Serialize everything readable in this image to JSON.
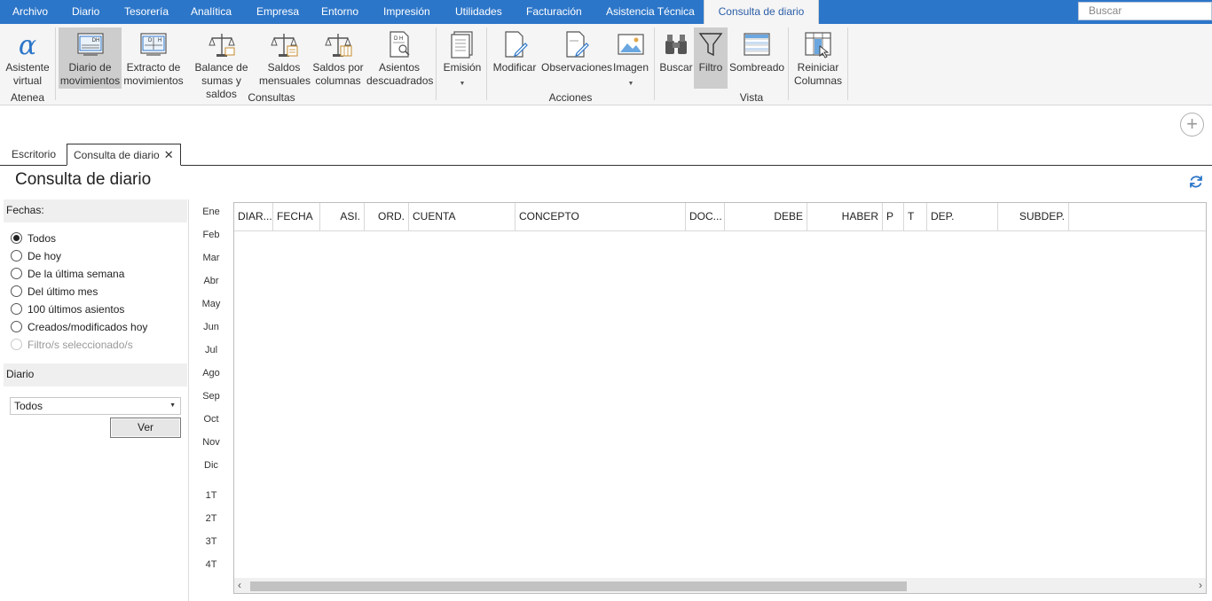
{
  "menu": {
    "items": [
      "Archivo",
      "Diario",
      "Tesorería",
      "Analítica",
      "Empresa",
      "Entorno",
      "Impresión",
      "Utilidades",
      "Facturación",
      "Asistencia Técnica"
    ],
    "active_item": "Consulta de diario",
    "search_placeholder": "Buscar"
  },
  "ribbon": {
    "atenea": {
      "group": "Atenea",
      "asistente": [
        "Asistente",
        "virtual"
      ]
    },
    "consultas": {
      "group": "Consultas",
      "diario_movimientos": [
        "Diario de",
        "movimientos"
      ],
      "extracto": [
        "Extracto de",
        "movimientos"
      ],
      "balance": [
        "Balance de",
        "sumas y saldos"
      ],
      "saldos_mensuales": [
        "Saldos",
        "mensuales"
      ],
      "saldos_columnas": [
        "Saldos por",
        "columnas"
      ],
      "asientos_descuadrados": [
        "Asientos",
        "descuadrados"
      ]
    },
    "emision": {
      "label": "Emisión"
    },
    "acciones": {
      "group": "Acciones",
      "modificar": "Modificar",
      "observaciones": "Observaciones",
      "imagen": "Imagen"
    },
    "vista": {
      "group": "Vista",
      "buscar": "Buscar",
      "filtro": "Filtro",
      "sombreado": "Sombreado",
      "reiniciar": [
        "Reiniciar",
        "Columnas"
      ]
    }
  },
  "tabs": {
    "escritorio": "Escritorio",
    "consulta": "Consulta de diario"
  },
  "page": {
    "title": "Consulta de diario"
  },
  "filters": {
    "fechas_label": "Fechas:",
    "options": [
      "Todos",
      "De hoy",
      "De la última semana",
      "Del último mes",
      "100 últimos asientos",
      "Creados/modificados hoy",
      "Filtro/s seleccionado/s"
    ],
    "selected": "Todos",
    "diario_label": "Diario",
    "diario_value": "Todos",
    "ver_button": "Ver"
  },
  "months": [
    "Ene",
    "Feb",
    "Mar",
    "Abr",
    "May",
    "Jun",
    "Jul",
    "Ago",
    "Sep",
    "Oct",
    "Nov",
    "Dic"
  ],
  "quarters": [
    "1T",
    "2T",
    "3T",
    "4T"
  ],
  "grid": {
    "columns": [
      "DIAR...",
      "FECHA",
      "ASI.",
      "ORD.",
      "CUENTA",
      "CONCEPTO",
      "DOC...",
      "DEBE",
      "HABER",
      "P",
      "T",
      "DEP.",
      "SUBDEP."
    ]
  },
  "colors": {
    "menubar": "#2c76c9",
    "active_tab_text": "#2c5ea8",
    "refresh": "#2c76c9"
  }
}
